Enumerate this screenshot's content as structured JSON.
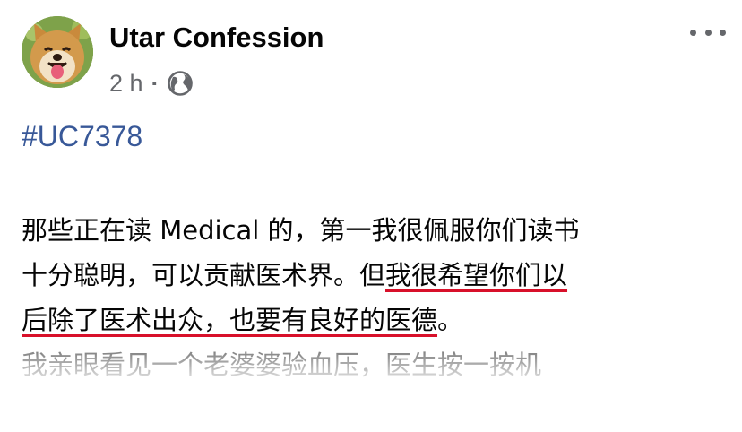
{
  "post": {
    "page_name": "Utar Confession",
    "time": "2 h",
    "separator": "·",
    "privacy_icon": "globe-icon",
    "menu_icon": "more-horizontal-icon",
    "hashtag": "#UC7378",
    "body": {
      "line1": "那些正在读 Medical 的，第一我很佩服你们读书",
      "line2_a": "十分聪明，可以贡献医术界。但",
      "line2_b": "我很希望你们以",
      "line3_a": "后除了医术出众，也要有良好的医德",
      "line3_b": "。",
      "line4": "我亲眼看见一个老婆婆验血压，医生按一按机"
    }
  },
  "colors": {
    "hashtag": "#385898",
    "underline": "#d8102a",
    "meta": "#65676b"
  }
}
